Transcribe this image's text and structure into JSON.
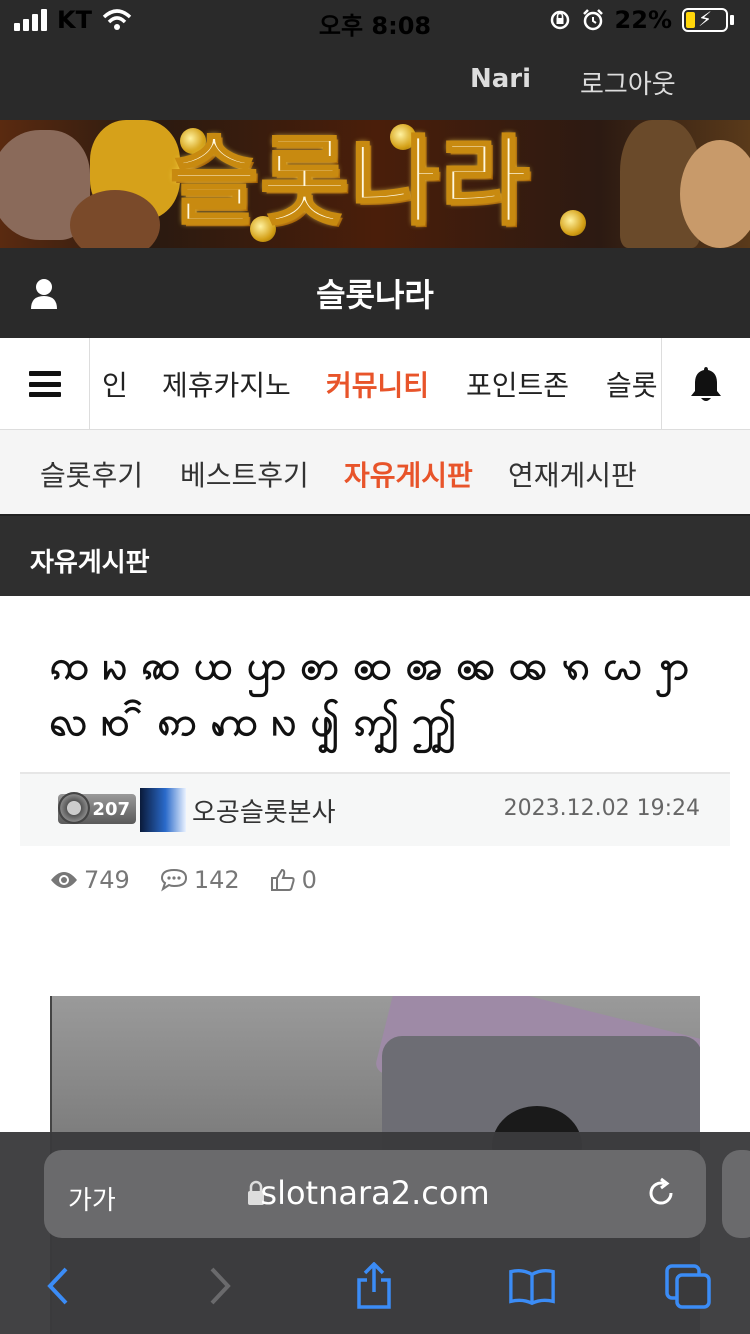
{
  "status_bar": {
    "carrier": "KT",
    "time": "오후 8:08",
    "battery": "22%"
  },
  "top_nav": {
    "user": "Nari",
    "logout": "로그아웃"
  },
  "banner": {
    "title": "슬롯나라"
  },
  "site_header": {
    "title": "슬롯나라"
  },
  "main_menu": {
    "items": [
      "인",
      "제휴카지노",
      "커뮤니티",
      "포인트존",
      "슬롯"
    ],
    "active": "커뮤니티"
  },
  "sub_menu": {
    "items": [
      "슬롯후기",
      "베스트후기",
      "자유게시판",
      "연재게시판"
    ],
    "active": "자유게시판"
  },
  "board": {
    "title": "자유게시판"
  },
  "post": {
    "title": "ꩡ ꩢ ꩣ ꩤ ꩥ ꩦ ꩧ ꩨ ꩩ ꩪ ꩫ ꩬ ꩭ ꩮ ꩯ ꩰ ꩱ ꩲ ꩳ ꩴ ꩵ ꩶ",
    "level": "207",
    "author": "오공슬롯본사",
    "date": "2023.12.02 19:24",
    "views": "749",
    "comments": "142",
    "likes": "0"
  },
  "browser": {
    "text_size": "가가",
    "url": "slotnara2.com"
  },
  "colors": {
    "accent": "#e8542a",
    "dark_bar": "#2a2a2a"
  }
}
